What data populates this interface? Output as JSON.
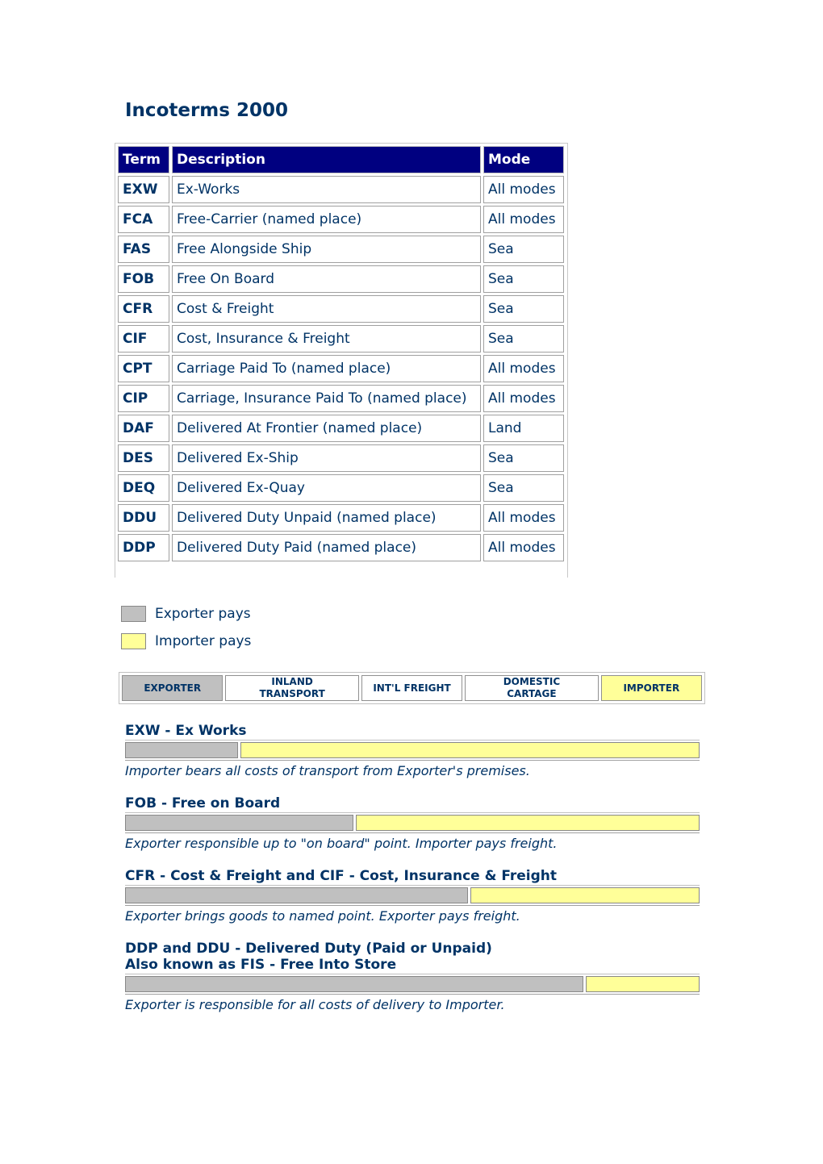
{
  "title": "Incoterms 2000",
  "table": {
    "headers": [
      "Term",
      "Description",
      "Mode"
    ],
    "rows": [
      {
        "term": "EXW",
        "description": "Ex-Works",
        "mode": "All modes"
      },
      {
        "term": "FCA",
        "description": "Free-Carrier (named place)",
        "mode": "All modes"
      },
      {
        "term": "FAS",
        "description": "Free Alongside Ship",
        "mode": "Sea"
      },
      {
        "term": "FOB",
        "description": "Free On Board",
        "mode": "Sea"
      },
      {
        "term": "CFR",
        "description": "Cost & Freight",
        "mode": "Sea"
      },
      {
        "term": "CIF",
        "description": "Cost, Insurance & Freight",
        "mode": "Sea"
      },
      {
        "term": "CPT",
        "description": "Carriage Paid To (named place)",
        "mode": "All modes"
      },
      {
        "term": "CIP",
        "description": "Carriage, Insurance Paid To (named place)",
        "mode": "All modes"
      },
      {
        "term": "DAF",
        "description": "Delivered At Frontier (named place)",
        "mode": "Land"
      },
      {
        "term": "DES",
        "description": "Delivered Ex-Ship",
        "mode": "Sea"
      },
      {
        "term": "DEQ",
        "description": "Delivered Ex-Quay",
        "mode": "Sea"
      },
      {
        "term": "DDU",
        "description": "Delivered Duty Unpaid (named place)",
        "mode": "All modes"
      },
      {
        "term": "DDP",
        "description": "Delivered Duty Paid (named place)",
        "mode": "All modes"
      }
    ]
  },
  "legend": {
    "exporter": "Exporter pays",
    "importer": "Importer pays"
  },
  "colors": {
    "exporter": "#c0c0c0",
    "importer": "#ffff99",
    "header_bg": "#000080",
    "text": "#003366"
  },
  "flow": {
    "stages": [
      {
        "label": "EXPORTER",
        "style": "gray"
      },
      {
        "label": "INLAND TRANSPORT",
        "style": "white"
      },
      {
        "label": "INT'L FREIGHT",
        "style": "white"
      },
      {
        "label": "DOMESTIC CARTAGE",
        "style": "white"
      },
      {
        "label": "IMPORTER",
        "style": "yellow"
      }
    ]
  },
  "sections": [
    {
      "title": "EXW - Ex Works",
      "subtitle": "",
      "exporter_share": 0.2,
      "note": "Importer bears all costs of transport from Exporter's premises."
    },
    {
      "title": "FOB - Free on Board",
      "subtitle": "",
      "exporter_share": 0.4,
      "note": "Exporter responsible up to \"on board\" point. Importer pays freight."
    },
    {
      "title": "CFR - Cost & Freight and CIF - Cost, Insurance & Freight",
      "subtitle": "",
      "exporter_share": 0.6,
      "note": "Exporter brings goods to named point. Exporter pays freight."
    },
    {
      "title": "DDP and DDU - Delivered Duty (Paid or Unpaid)",
      "subtitle": "Also known as FIS - Free Into Store",
      "exporter_share": 0.8,
      "note": "Exporter is responsible for all costs of delivery to Importer."
    }
  ]
}
